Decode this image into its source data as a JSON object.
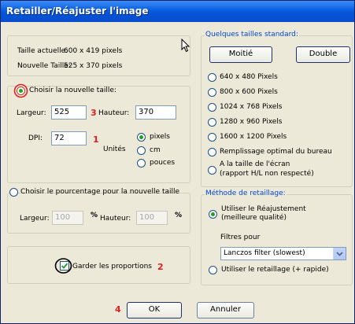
{
  "title": "Retailler/Réajuster l'image",
  "sizes": {
    "current_label": "Taille actuelle:",
    "current_value": "600 x 419 pixels",
    "new_label": "Nouvelle Taille:",
    "new_value": "525 x 370 pixels"
  },
  "standard": {
    "legend": "Quelques tailles standard:",
    "half_button": "Moitié",
    "double_button": "Double",
    "options": [
      "640 x 480 Pixels",
      "800 x 600 Pixels",
      "1024 x 768 Pixels",
      "1280 x 960 Pixels",
      "1600 x 1200 Pixels",
      "Remplissage optimal du bureau",
      "A la taille de l'écran",
      "(rapport H/L non respecté)"
    ]
  },
  "new_size": {
    "option_label": "Choisir la nouvelle taille:",
    "width_label": "Largeur:",
    "width_value": "525",
    "height_label": "Hauteur:",
    "height_value": "370",
    "dpi_label": "DPI:",
    "dpi_value": "72",
    "units_label": "Unités",
    "unit_pixels": "pixels",
    "unit_cm": "cm",
    "unit_pouces": "pouces"
  },
  "percent": {
    "option_label": "Choisir le pourcentage pour la nouvelle taille",
    "width_label": "Largeur:",
    "width_value": "100",
    "percent_sign": "%",
    "height_label": "Hauteur:",
    "height_value": "100"
  },
  "keep_proportions_label": "Garder les proportions",
  "method": {
    "legend": "Méthode de retaillage:",
    "resample_line1": "Utiliser le  Réajustement",
    "resample_line2": "(meilleure qualité)",
    "filters_label": "Filtres pour",
    "filter_value": "Lanczos filter (slowest)",
    "resize_option": "Utiliser le retaillage (+ rapide)"
  },
  "buttons": {
    "ok": "OK",
    "cancel": "Annuler"
  },
  "markers": {
    "m1": "1",
    "m2": "2",
    "m3": "3",
    "m4": "4"
  }
}
